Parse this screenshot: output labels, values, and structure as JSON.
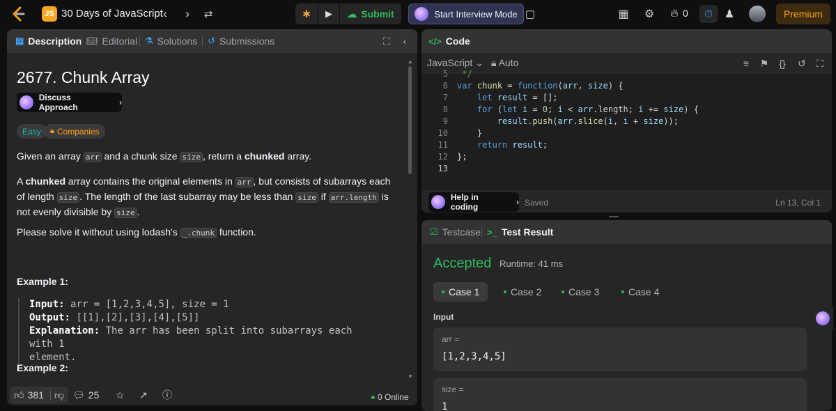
{
  "topbar": {
    "title": "30 Days of JavaScript",
    "js_badge": "JS",
    "submit_label": "Submit",
    "interview_label": "Start Interview Mode",
    "streak_count": "0",
    "premium_label": "Premium"
  },
  "left": {
    "tabs": {
      "description": "Description",
      "editorial": "Editorial",
      "solutions": "Solutions",
      "submissions": "Submissions"
    },
    "problem_title": "2677. Chunk Array",
    "discuss_label": "Discuss Approach",
    "difficulty": "Easy",
    "companies": "Companies",
    "example1_title": "Example 1:",
    "example2_title": "Example 2:",
    "example1": {
      "input_label": "Input:",
      "input": "arr = [1,2,3,4,5], size = 1",
      "output_label": "Output:",
      "output": "[[1],[2],[3],[4],[5]]",
      "explanation_label": "Explanation:",
      "explanation_1": "The arr has been split into subarrays each with 1",
      "explanation_2": "element."
    },
    "footer": {
      "likes": "381",
      "comments": "25",
      "online": "0 Online"
    }
  },
  "code": {
    "header": "Code",
    "language": "JavaScript",
    "auto": "Auto",
    "lines": [
      {
        "n": "5",
        "t": " */"
      },
      {
        "n": "6",
        "t": "var chunk = function(arr, size) {"
      },
      {
        "n": "7",
        "t": "    let result = [];"
      },
      {
        "n": "8",
        "t": "    for (let i = 0; i < arr.length; i += size) {"
      },
      {
        "n": "9",
        "t": "        result.push(arr.slice(i, i + size));"
      },
      {
        "n": "10",
        "t": "    }"
      },
      {
        "n": "11",
        "t": "    return result;"
      },
      {
        "n": "12",
        "t": "};"
      },
      {
        "n": "13",
        "t": ""
      }
    ],
    "help_label": "Help in coding",
    "saved": "Saved",
    "cursor": "Ln 13, Col 1"
  },
  "result": {
    "tab_testcase": "Testcase",
    "tab_result": "Test Result",
    "status": "Accepted",
    "runtime": "Runtime: 41 ms",
    "cases": [
      "Case 1",
      "Case 2",
      "Case 3",
      "Case 4"
    ],
    "input_label": "Input",
    "arr_key": "arr =",
    "arr_val": "[1,2,3,4,5]",
    "size_key": "size =",
    "size_val": "1"
  }
}
